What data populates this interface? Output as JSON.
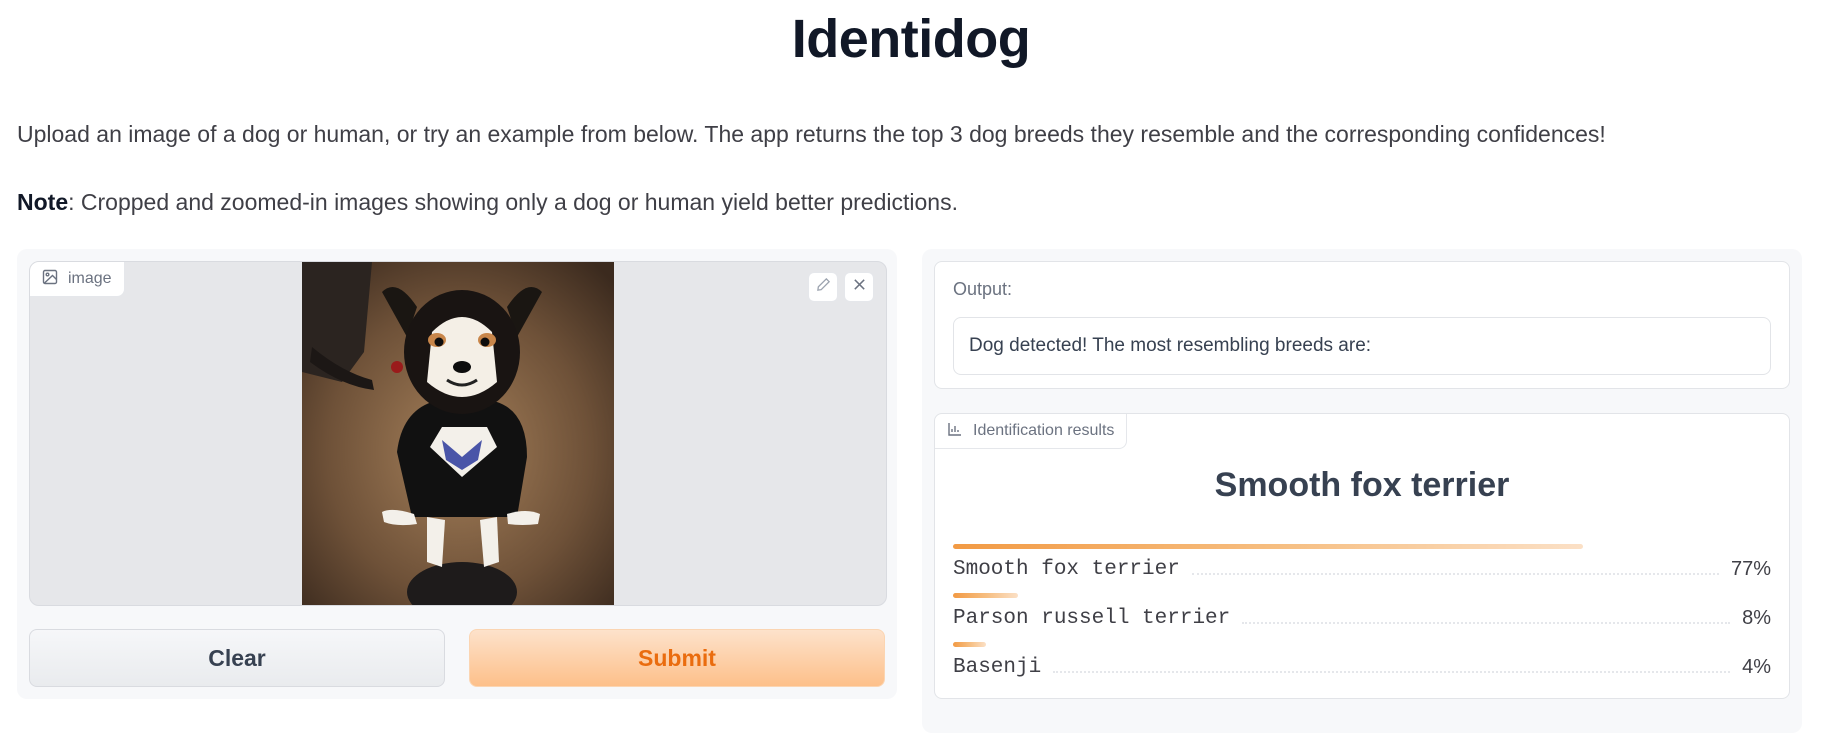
{
  "app": {
    "title": "Identidog",
    "description": "Upload an image of a dog or human, or try an example from below. The app returns the top 3 dog breeds they resemble and the corresponding confidences!",
    "note_bold": "Note",
    "note_text": ": Cropped and zoomed-in images showing only a dog or human yield better predictions."
  },
  "image_input": {
    "label": "image",
    "label_icon": "image-icon",
    "edit_icon": "pencil-icon",
    "remove_icon": "close-icon"
  },
  "buttons": {
    "clear": "Clear",
    "submit": "Submit"
  },
  "output": {
    "label": "Output:",
    "value": "Dog detected! The most resembling breeds are:"
  },
  "results": {
    "label": "Identification results",
    "label_icon": "bar-chart-icon",
    "top": "Smooth fox terrier",
    "items": [
      {
        "name": "Smooth fox terrier",
        "pct": "77%",
        "confidence": 0.77
      },
      {
        "name": "Parson russell terrier",
        "pct": "8%",
        "confidence": 0.08
      },
      {
        "name": "Basenji",
        "pct": "4%",
        "confidence": 0.04
      }
    ]
  },
  "colors": {
    "accent": "#f29a44",
    "submit_text": "#ea6c0e"
  }
}
